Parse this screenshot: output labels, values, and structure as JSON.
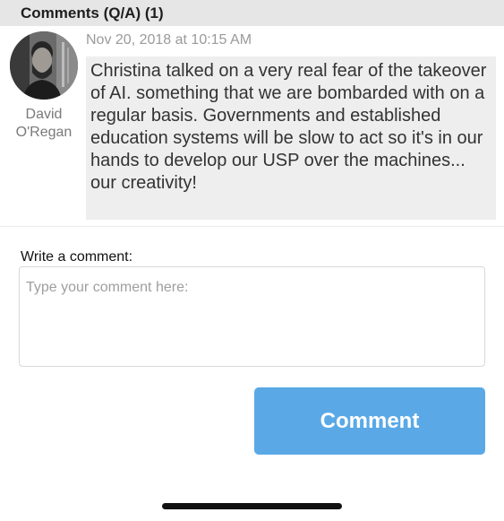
{
  "header": {
    "title": "Comments (Q/A)  (1)"
  },
  "comments": [
    {
      "author_first": "David",
      "author_last": "O'Regan",
      "timestamp": "Nov 20, 2018 at 10:15 AM",
      "text": "Christina talked on a very real fear of the takeover of AI. something that we are bombarded with on a regular basis. Governments and established education systems will be slow to act so it's in our hands to develop our USP over the machines... our creativity!",
      "avatar_icon": "user-photo"
    }
  ],
  "form": {
    "label": "Write a comment:",
    "placeholder": "Type your comment here:",
    "value": "",
    "button_label": "Comment"
  },
  "colors": {
    "header_bg": "#e6e6e6",
    "bubble_bg": "#eeeeee",
    "button_bg": "#5aa9e6"
  }
}
